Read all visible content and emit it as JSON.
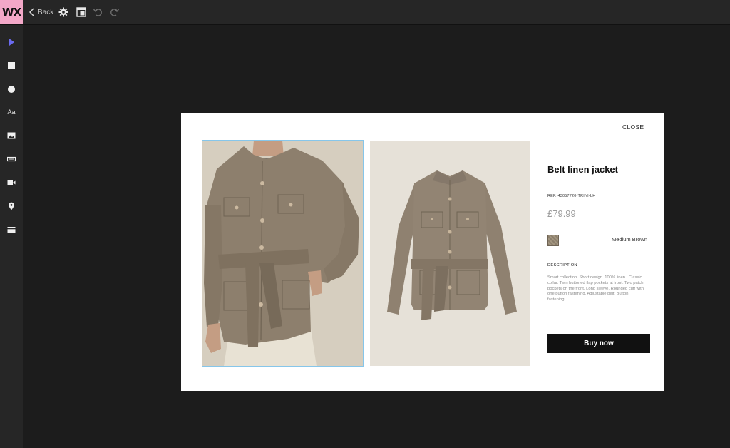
{
  "app": {
    "logo_text": "WX",
    "back_label": "Back",
    "icons": {
      "back": "chevron-left-icon",
      "settings": "gear-icon",
      "layout": "layout-icon",
      "undo": "undo-icon",
      "redo": "redo-icon"
    }
  },
  "tools": [
    {
      "name": "select",
      "icon": "cursor-arrow-icon"
    },
    {
      "name": "rectangle",
      "icon": "square-icon"
    },
    {
      "name": "circle",
      "icon": "circle-icon"
    },
    {
      "name": "text",
      "label": "Aa"
    },
    {
      "name": "image",
      "icon": "image-icon"
    },
    {
      "name": "button",
      "icon": "button-icon"
    },
    {
      "name": "video",
      "icon": "video-camera-icon"
    },
    {
      "name": "map",
      "icon": "map-pin-icon"
    },
    {
      "name": "card",
      "icon": "card-icon"
    }
  ],
  "product": {
    "close_label": "CLOSE",
    "title": "Belt linen jacket",
    "ref": "REF. 43057720-TRINI-LH",
    "price": "£79.99",
    "color_name": "Medium Brown",
    "description_heading": "DESCRIPTION",
    "description": "Smart collection. Short design. 100% linen . Classic collar. Twin buttoned flap pockets at front. Two patch pockets on the front. Long sleeve. Rounded cuff with one button fastening. Adjustable belt. Button fastening.",
    "buy_label": "Buy now"
  },
  "colors": {
    "accent": "#6b6bf0",
    "logo_bg": "#f3a8c8",
    "selection": "#86c6ea",
    "jacket": "#8f8170"
  }
}
